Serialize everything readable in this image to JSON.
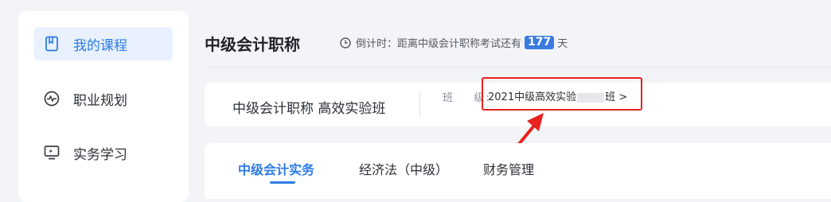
{
  "sidebar": {
    "items": [
      {
        "label": "我的课程",
        "icon": "bookmark-icon",
        "active": true
      },
      {
        "label": "职业规划",
        "icon": "pulse-icon",
        "active": false
      },
      {
        "label": "实务学习",
        "icon": "monitor-icon",
        "active": false
      }
    ]
  },
  "header": {
    "title": "中级会计职称",
    "countdown_prefix": "倒计时：距离中级会计职称考试还有",
    "days": "177",
    "days_suffix": "天"
  },
  "class_info": {
    "course_name": "中级会计职称 高效实验班",
    "label": "班    级:",
    "value_start": "2021中级高效实验",
    "value_end": "班 >"
  },
  "tabs": [
    {
      "label": "中级会计实务",
      "active": true
    },
    {
      "label": "经济法（中级）",
      "active": false
    },
    {
      "label": "财务管理",
      "active": false
    }
  ],
  "colors": {
    "accent": "#2c7be5",
    "highlight": "#e8221d",
    "badge": "#3a7be0"
  }
}
